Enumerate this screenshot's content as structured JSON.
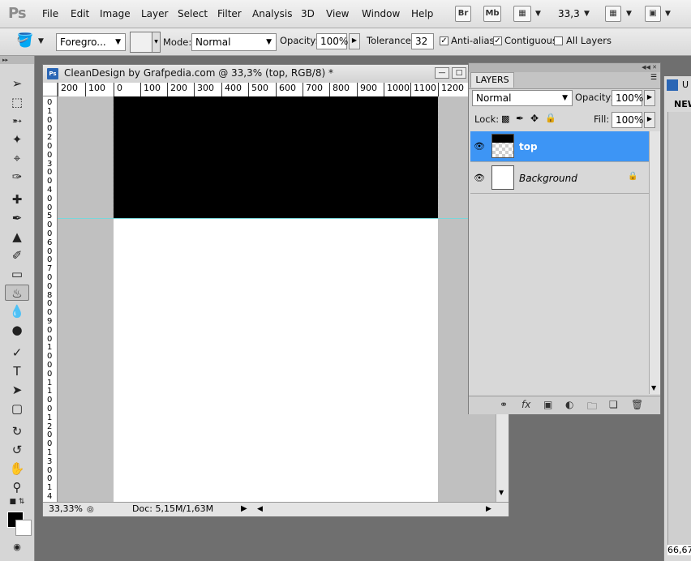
{
  "app": {
    "logo": "Ps"
  },
  "menu": [
    "File",
    "Edit",
    "Image",
    "Layer",
    "Select",
    "Filter",
    "Analysis",
    "3D",
    "View",
    "Window",
    "Help"
  ],
  "menubar_buttons": {
    "bridge": "Br",
    "mini_bridge": "Mb",
    "zoom": "33,3"
  },
  "options": {
    "fill_source": "Foregro...",
    "mode_label": "Mode:",
    "mode_value": "Normal",
    "opacity_label": "Opacity:",
    "opacity_value": "100%",
    "tolerance_label": "Tolerance:",
    "tolerance_value": "32",
    "antialias_label": "Anti-alias",
    "antialias_checked": true,
    "contiguous_label": "Contiguous",
    "contiguous_checked": true,
    "all_layers_label": "All Layers",
    "all_layers_checked": false
  },
  "document": {
    "title": "CleanDesign by Grafpedia.com @ 33,3% (top, RGB/8) *",
    "badge": "Ps",
    "hruler_labels": [
      "200",
      "100",
      "0",
      "100",
      "200",
      "300",
      "400",
      "500",
      "600",
      "700",
      "800",
      "900",
      "1000",
      "1100",
      "1200"
    ],
    "vruler_digits": [
      "0",
      "1",
      "0",
      "0",
      "2",
      "0",
      "0",
      "3",
      "0",
      "0",
      "4",
      "0",
      "0",
      "5",
      "0",
      "0",
      "6",
      "0",
      "0",
      "7",
      "0",
      "0",
      "8",
      "0",
      "0",
      "9",
      "0",
      "0",
      "1",
      "0",
      "0",
      "0",
      "1",
      "1",
      "0",
      "0",
      "1",
      "2",
      "0",
      "0",
      "1",
      "3",
      "0",
      "0",
      "1",
      "4"
    ],
    "status_zoom": "33,33%",
    "status_doc": "Doc: 5,15M/1,63M"
  },
  "layers_panel": {
    "tab": "LAYERS",
    "blend_mode": "Normal",
    "opacity_label": "Opacity:",
    "opacity_value": "100%",
    "lock_label": "Lock:",
    "fill_label": "Fill:",
    "fill_value": "100%",
    "layers": [
      {
        "name": "top",
        "selected": true
      },
      {
        "name": "Background",
        "selected": false,
        "locked": true
      }
    ]
  },
  "right_panel": {
    "tab": "NEW",
    "partial_label": "U",
    "readout": "66,67"
  },
  "colors": {
    "selected_layer": "#3d95f5",
    "guide": "#7ad6da",
    "foreground": "#000000",
    "background": "#ffffff"
  }
}
